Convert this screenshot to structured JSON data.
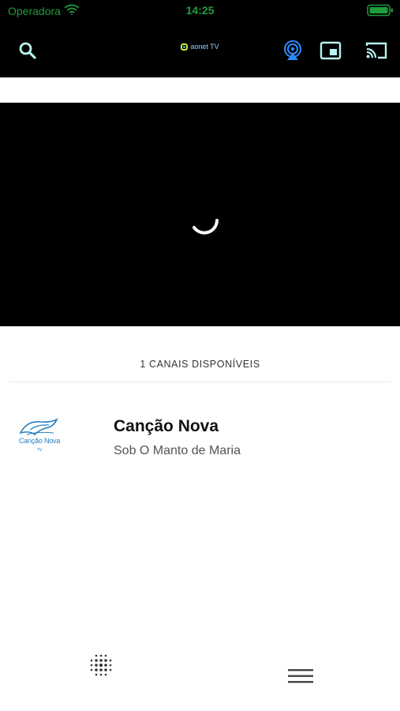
{
  "status_bar": {
    "carrier": "Operadora",
    "time": "14:25",
    "icons": [
      "wifi-icon",
      "battery-icon"
    ],
    "color": "#1f9d3a"
  },
  "toolbar": {
    "logo_text": "aonet TV",
    "icons": [
      "search-icon",
      "airplay-icon",
      "picture-in-picture-icon",
      "cast-icon"
    ],
    "icon_color": "#b9f2ee",
    "airplay_color": "#2b8cff"
  },
  "player": {
    "state_icon": "loading-spinner-icon"
  },
  "channels": {
    "count_label": "1 CANAIS DISPONÍVEIS",
    "items": [
      {
        "logo_text": "Canção Nova",
        "logo_subtext": "TV",
        "name": "Canção Nova",
        "program": "Sob O Manto de Maria"
      }
    ]
  },
  "bottom_bar": {
    "icons": [
      "dots-grid-icon",
      "hamburger-menu-icon"
    ]
  }
}
